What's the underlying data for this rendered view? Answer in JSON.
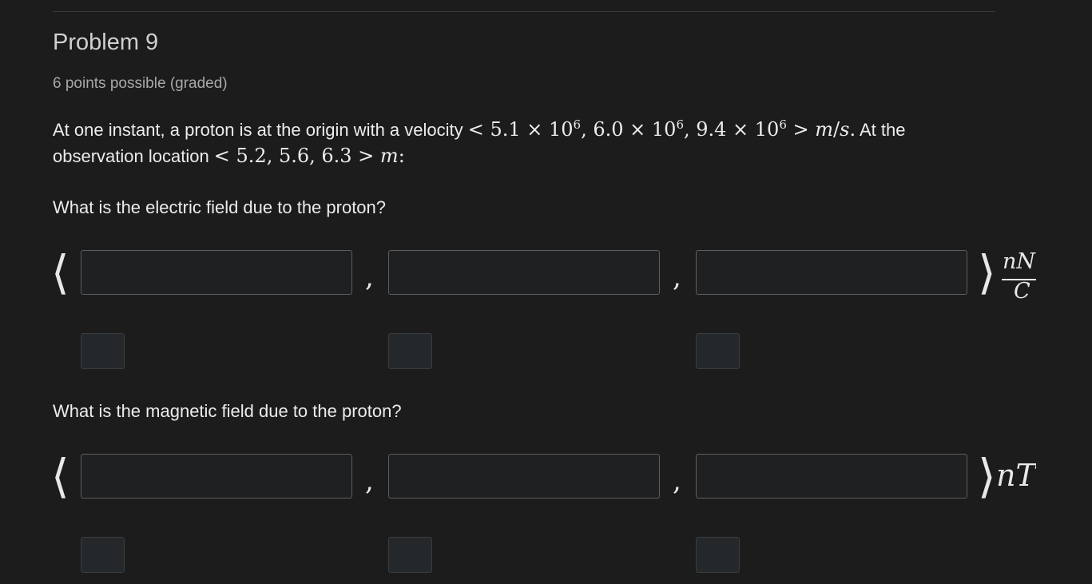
{
  "problem": {
    "title": "Problem 9",
    "points": "6 points possible (graded)",
    "statement": {
      "prefix": "At one instant, a proton is at the origin with a velocity ",
      "velocity_math": "< 5.1 × 10⁶, 6.0 × 10⁶, 9.4 × 10⁶ > m/s.",
      "middle": " At the observation location ",
      "location_math": "< 5.2, 5.6, 6.3 > m:"
    }
  },
  "electric": {
    "question": "What is the electric field due to the proton?",
    "left_bracket": "⟨",
    "right_bracket": "⟩",
    "comma": ",",
    "unit_numerator": "nN",
    "unit_denominator": "C",
    "inputs": [
      {
        "value": "",
        "placeholder": ""
      },
      {
        "value": "",
        "placeholder": ""
      },
      {
        "value": "",
        "placeholder": ""
      }
    ]
  },
  "magnetic": {
    "question": "What is the magnetic field due to the proton?",
    "left_bracket": "⟨",
    "right_bracket": "⟩",
    "comma": ",",
    "unit": "nT",
    "inputs": [
      {
        "value": "",
        "placeholder": ""
      },
      {
        "value": "",
        "placeholder": ""
      },
      {
        "value": "",
        "placeholder": ""
      }
    ]
  }
}
